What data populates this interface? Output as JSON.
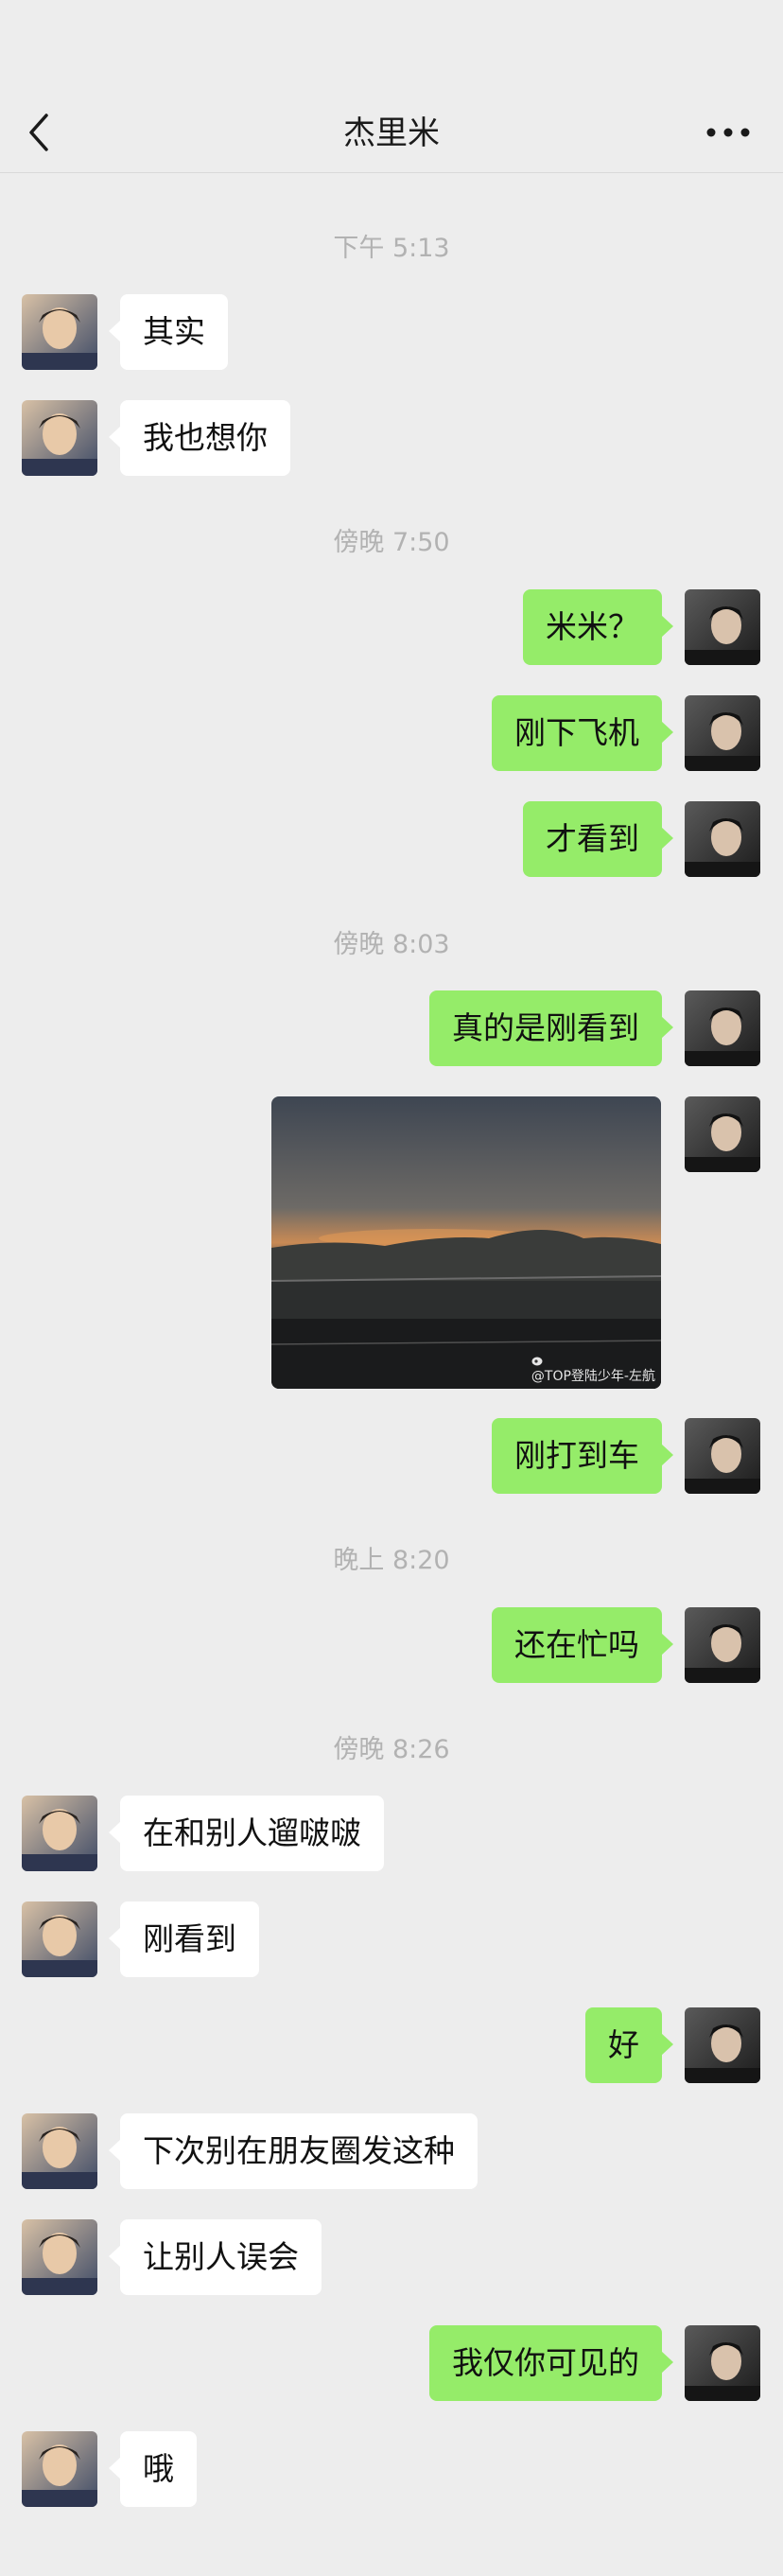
{
  "header": {
    "title": "杰里米"
  },
  "messages": [
    {
      "type": "time",
      "text": "下午 5:13"
    },
    {
      "type": "msg",
      "side": "left",
      "text": "其实"
    },
    {
      "type": "msg",
      "side": "left",
      "text": "我也想你"
    },
    {
      "type": "time",
      "text": "傍晚 7:50"
    },
    {
      "type": "msg",
      "side": "right",
      "text": "米米？"
    },
    {
      "type": "msg",
      "side": "right",
      "text": "刚下飞机"
    },
    {
      "type": "msg",
      "side": "right",
      "text": "才看到"
    },
    {
      "type": "time",
      "text": "傍晚 8:03"
    },
    {
      "type": "msg",
      "side": "right",
      "text": "真的是刚看到"
    },
    {
      "type": "image",
      "side": "right",
      "watermark": "@TOP登陆少年-左航"
    },
    {
      "type": "msg",
      "side": "right",
      "text": "刚打到车"
    },
    {
      "type": "time",
      "text": "晚上 8:20"
    },
    {
      "type": "msg",
      "side": "right",
      "text": "还在忙吗"
    },
    {
      "type": "time",
      "text": "傍晚 8:26"
    },
    {
      "type": "msg",
      "side": "left",
      "text": "在和别人遛啵啵"
    },
    {
      "type": "msg",
      "side": "left",
      "text": "刚看到"
    },
    {
      "type": "msg",
      "side": "right",
      "text": "好"
    },
    {
      "type": "msg",
      "side": "left",
      "text": "下次别在朋友圈发这种"
    },
    {
      "type": "msg",
      "side": "left",
      "text": "让别人误会"
    },
    {
      "type": "msg",
      "side": "right",
      "text": "我仅你可见的"
    },
    {
      "type": "msg",
      "side": "left",
      "text": "哦"
    }
  ],
  "colors": {
    "background": "#ededed",
    "self_bubble": "#95ec69",
    "other_bubble": "#ffffff",
    "timestamp": "#b2b2b2"
  },
  "icons": {
    "back": "chevron-left-icon",
    "more": "more-dots-icon"
  }
}
